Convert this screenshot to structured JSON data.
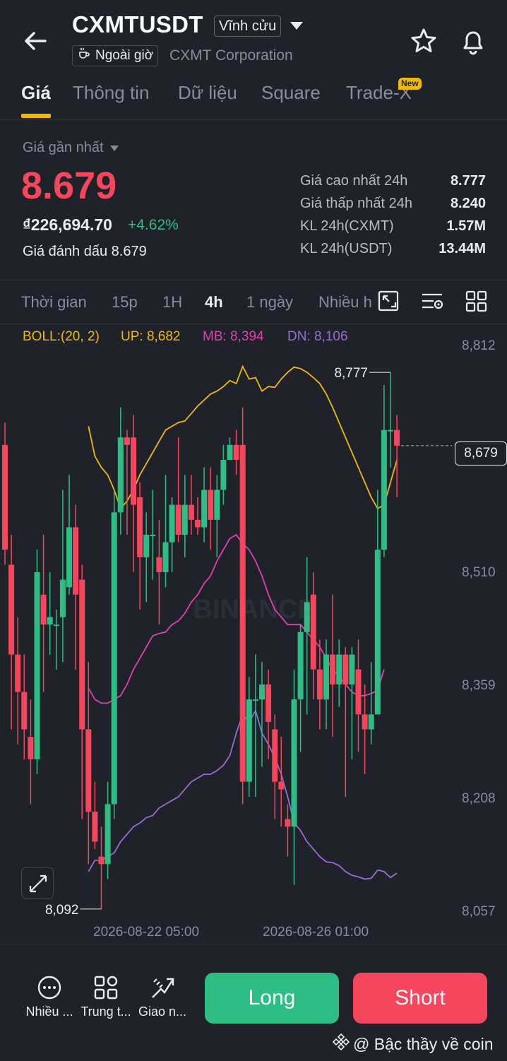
{
  "header": {
    "symbol": "CXMTUSDT",
    "contract_type": "Vĩnh cửu",
    "session_badge": "Ngoài giờ",
    "company": "CXMT Corporation"
  },
  "tabs": [
    {
      "label": "Giá",
      "active": true
    },
    {
      "label": "Thông tin"
    },
    {
      "label": "Dữ liệu"
    },
    {
      "label": "Square"
    },
    {
      "label": "Trade-X",
      "badge": "New"
    }
  ],
  "price": {
    "label": "Giá gần nhất",
    "last": "8.679",
    "fiat": "₫226,694.70",
    "change": "+4.62%",
    "mark_label": "Giá đánh dấu",
    "mark_value": "8.679"
  },
  "stats": [
    {
      "label": "Giá cao nhất 24h",
      "value": "8.777"
    },
    {
      "label": "Giá thấp nhất 24h",
      "value": "8.240"
    },
    {
      "label": "KL 24h(CXMT)",
      "value": "1.57M"
    },
    {
      "label": "KL 24h(USDT)",
      "value": "13.44M"
    }
  ],
  "timeframes": [
    {
      "label": "Thời gian"
    },
    {
      "label": "15p"
    },
    {
      "label": "1H"
    },
    {
      "label": "4h",
      "active": true
    },
    {
      "label": "1 ngày"
    },
    {
      "label": "Nhiều h"
    }
  ],
  "indicator": {
    "boll": "BOLL:(20, 2)",
    "up": "UP: 8,682",
    "mb": "MB: 8,394",
    "dn": "DN: 8,106"
  },
  "colors": {
    "up": "#2ebd85",
    "down": "#f6465d",
    "accent": "#f0b90b",
    "boll_up": "#f0b90b",
    "boll_mb": "#e040b0",
    "boll_dn": "#9b6ad6"
  },
  "chart_data": {
    "type": "candlestick",
    "y_ticks": [
      "8,812",
      "8,510",
      "8,359",
      "8,208",
      "8,057"
    ],
    "x_ticks": [
      "2026-08-22 05:00",
      "2026-08-26 01:00"
    ],
    "high_label": "8,777",
    "low_label": "8,092",
    "last_price_tag": "8,679",
    "ylim": [
      8057,
      8812
    ],
    "candles": [
      [
        8680,
        8540,
        8710,
        8520
      ],
      [
        8520,
        8400,
        8560,
        8300
      ],
      [
        8400,
        8350,
        8450,
        8280
      ],
      [
        8350,
        8300,
        8400,
        8260
      ],
      [
        8290,
        8260,
        8340,
        8200
      ],
      [
        8260,
        8510,
        8540,
        8240
      ],
      [
        8480,
        8440,
        8560,
        8350
      ],
      [
        8440,
        8450,
        8510,
        8400
      ],
      [
        8440,
        8440,
        8460,
        8380
      ],
      [
        8450,
        8500,
        8620,
        8390
      ],
      [
        8490,
        8570,
        8640,
        8480
      ],
      [
        8570,
        8480,
        8600,
        8380
      ],
      [
        8500,
        8300,
        8520,
        8180
      ],
      [
        8300,
        8190,
        8390,
        8120
      ],
      [
        8190,
        8150,
        8230,
        8140
      ],
      [
        8130,
        8120,
        8170,
        8060
      ],
      [
        8120,
        8200,
        8230,
        8100
      ],
      [
        8200,
        8590,
        8620,
        8180
      ],
      [
        8590,
        8690,
        8730,
        8560
      ],
      [
        8690,
        8680,
        8700,
        8560
      ],
      [
        8690,
        8600,
        8720,
        8510
      ],
      [
        8610,
        8530,
        8630,
        8460
      ],
      [
        8530,
        8560,
        8590,
        8470
      ],
      [
        8560,
        8560,
        8620,
        8500
      ],
      [
        8530,
        8510,
        8580,
        8440
      ],
      [
        8510,
        8550,
        8640,
        8490
      ],
      [
        8550,
        8600,
        8610,
        8510
      ],
      [
        8600,
        8560,
        8690,
        8550
      ],
      [
        8560,
        8600,
        8640,
        8530
      ],
      [
        8600,
        8580,
        8640,
        8560
      ],
      [
        8580,
        8570,
        8610,
        8560
      ],
      [
        8570,
        8620,
        8650,
        8550
      ],
      [
        8620,
        8580,
        8650,
        8540
      ],
      [
        8580,
        8620,
        8640,
        8530
      ],
      [
        8620,
        8660,
        8680,
        8600
      ],
      [
        8660,
        8680,
        8690,
        8670
      ],
      [
        8680,
        8660,
        8700,
        8640
      ],
      [
        8680,
        8230,
        8730,
        8200
      ],
      [
        8230,
        8340,
        8370,
        8210
      ],
      [
        8340,
        8340,
        8400,
        8210
      ],
      [
        8340,
        8360,
        8390,
        8250
      ],
      [
        8360,
        8310,
        8380,
        8260
      ],
      [
        8300,
        8230,
        8320,
        8180
      ],
      [
        8230,
        8220,
        8290,
        8170
      ],
      [
        8180,
        8170,
        8200,
        8130
      ],
      [
        8170,
        8340,
        8380,
        8092
      ],
      [
        8340,
        8430,
        8440,
        8270
      ],
      [
        8430,
        8470,
        8530,
        8320
      ],
      [
        8480,
        8380,
        8510,
        8340
      ],
      [
        8380,
        8340,
        8420,
        8300
      ],
      [
        8340,
        8400,
        8420,
        8300
      ],
      [
        8400,
        8360,
        8480,
        8290
      ],
      [
        8360,
        8400,
        8420,
        8330
      ],
      [
        8400,
        8360,
        8410,
        8210
      ],
      [
        8360,
        8400,
        8410,
        8260
      ],
      [
        8380,
        8320,
        8420,
        8270
      ],
      [
        8320,
        8300,
        8360,
        8240
      ],
      [
        8300,
        8320,
        8390,
        8280
      ],
      [
        8320,
        8540,
        8620,
        8320
      ],
      [
        8540,
        8700,
        8760,
        8530
      ],
      [
        8700,
        8700,
        8777,
        8650
      ],
      [
        8700,
        8679,
        8720,
        8610
      ]
    ],
    "boll_up": [
      null,
      null,
      null,
      null,
      null,
      null,
      null,
      null,
      null,
      null,
      null,
      8705,
      8665,
      8650,
      8640,
      8620,
      8595,
      8605,
      8620,
      8640,
      8655,
      8670,
      8685,
      8700,
      8705,
      8710,
      8712,
      8722,
      8732,
      8740,
      8748,
      8752,
      8758,
      8766,
      8762,
      8785,
      8768,
      8770,
      8752,
      8758,
      8757,
      8768,
      8777,
      8784,
      8782,
      8777,
      8770,
      8762,
      8748,
      8730,
      8710,
      8690,
      8670,
      8650,
      8630,
      8610,
      8595,
      8600,
      8630,
      8660
    ],
    "boll_mb": [
      null,
      null,
      null,
      null,
      null,
      null,
      null,
      null,
      null,
      null,
      null,
      8355,
      8340,
      8335,
      8335,
      8340,
      8345,
      8360,
      8380,
      8395,
      8410,
      8425,
      8428,
      8430,
      8440,
      8445,
      8455,
      8470,
      8480,
      8495,
      8505,
      8525,
      8540,
      8555,
      8560,
      8548,
      8540,
      8525,
      8505,
      8480,
      8460,
      8450,
      8440,
      8440,
      8440,
      8430,
      8420,
      8410,
      8395,
      8380,
      8370,
      8360,
      8350,
      8345,
      8345,
      8348,
      8352,
      8380
    ],
    "boll_dn": [
      null,
      null,
      null,
      null,
      null,
      null,
      null,
      null,
      null,
      null,
      null,
      8110,
      8125,
      8125,
      8130,
      8135,
      8150,
      8160,
      8170,
      8175,
      8182,
      8185,
      8195,
      8200,
      8205,
      8210,
      8220,
      8230,
      8235,
      8240,
      8240,
      8245,
      8252,
      8265,
      8295,
      8320,
      8310,
      8325,
      8295,
      8280,
      8262,
      8240,
      8210,
      8175,
      8165,
      8150,
      8140,
      8130,
      8123,
      8122,
      8118,
      8110,
      8105,
      8103,
      8100,
      8101,
      8112,
      8110,
      8102,
      8108
    ]
  },
  "bottom_nav": [
    {
      "label": "Nhiều ...",
      "icon": "more-dots-icon"
    },
    {
      "label": "Trung t...",
      "icon": "grid-icon"
    },
    {
      "label": "Giao n...",
      "icon": "bot-icon"
    }
  ],
  "actions": {
    "long": "Long",
    "short": "Short"
  },
  "footer_watermark": "@ Bậc thầy về coin",
  "chart_watermark": "BINANCE"
}
